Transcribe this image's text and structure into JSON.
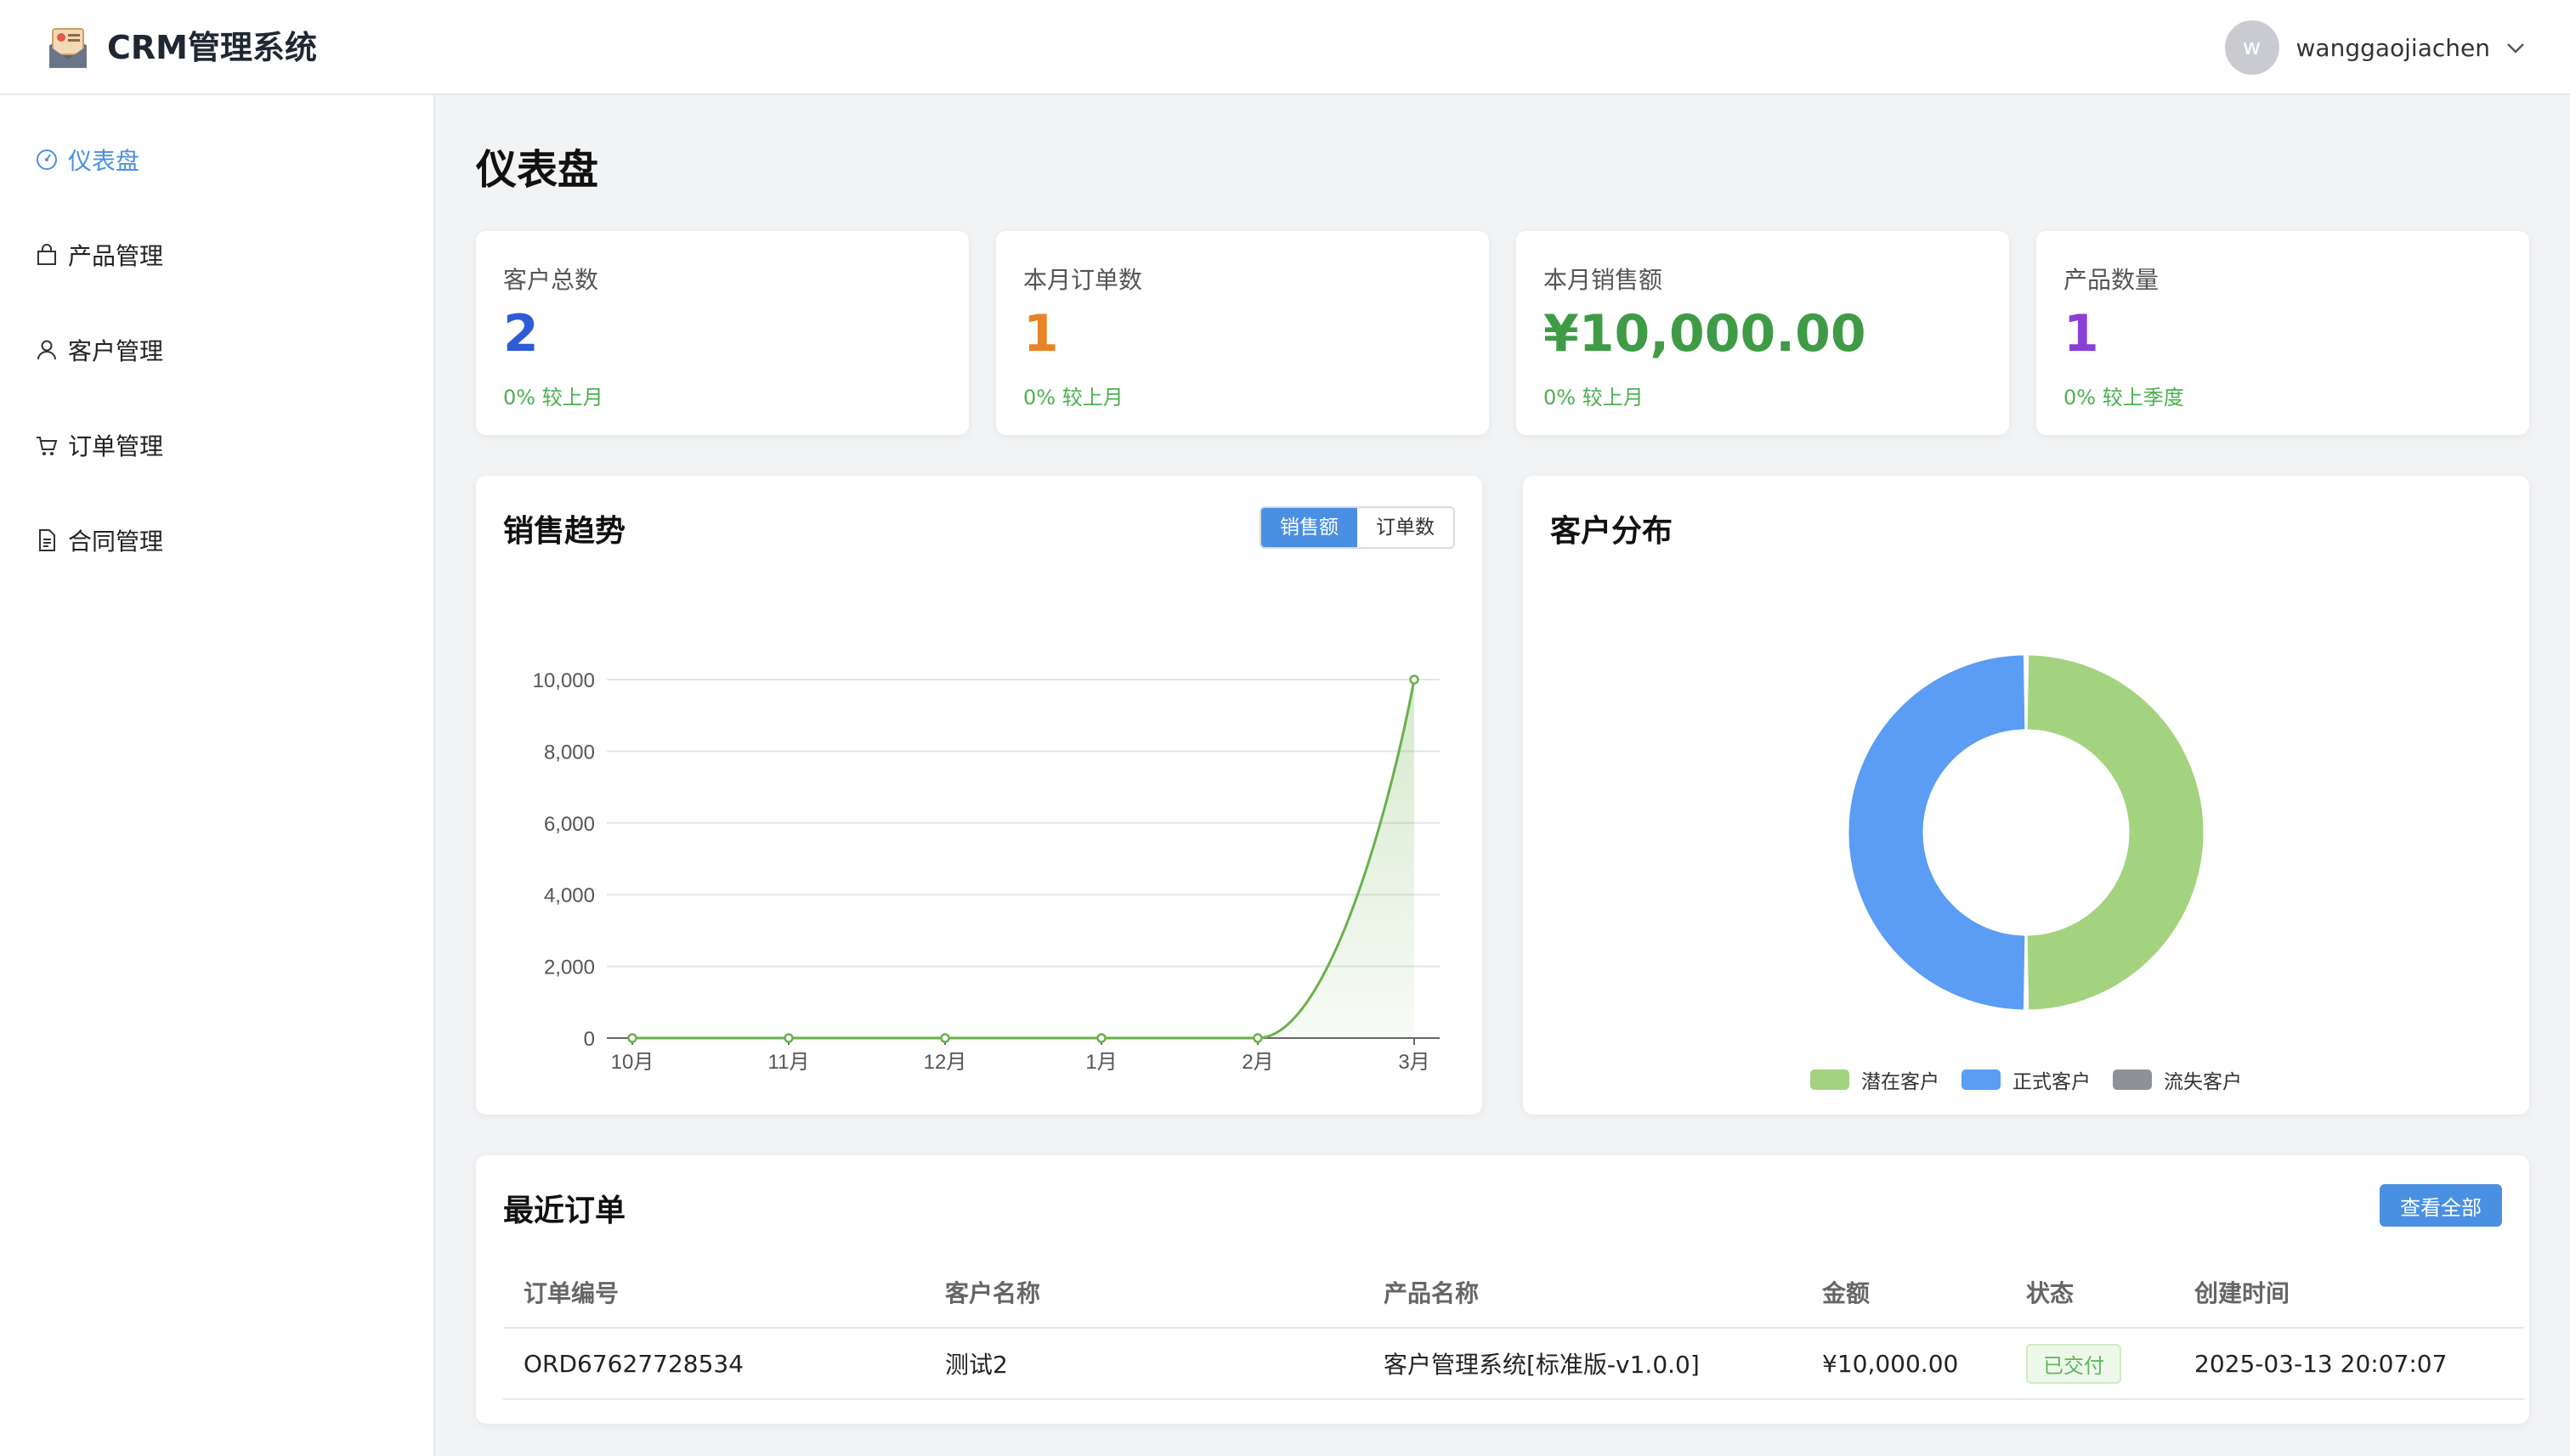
{
  "header": {
    "app_title": "CRM管理系统",
    "avatar_letter": "w",
    "username": "wanggaojiachen"
  },
  "sidebar": {
    "items": [
      {
        "label": "仪表盘",
        "icon": "dashboard-icon",
        "active": true
      },
      {
        "label": "产品管理",
        "icon": "shopping-bag-icon",
        "active": false
      },
      {
        "label": "客户管理",
        "icon": "user-icon",
        "active": false
      },
      {
        "label": "订单管理",
        "icon": "cart-icon",
        "active": false
      },
      {
        "label": "合同管理",
        "icon": "document-icon",
        "active": false
      }
    ]
  },
  "page": {
    "title": "仪表盘"
  },
  "stats": [
    {
      "label": "客户总数",
      "value": "2",
      "change": "0% 较上月",
      "color": "#2f5bd6"
    },
    {
      "label": "本月订单数",
      "value": "1",
      "change": "0% 较上月",
      "color": "#e8832a"
    },
    {
      "label": "本月销售额",
      "value": "¥10,000.00",
      "change": "0% 较上月",
      "color": "#3f9b45"
    },
    {
      "label": "产品数量",
      "value": "1",
      "change": "0% 较上季度",
      "color": "#8b3fd6"
    }
  ],
  "sales_panel": {
    "title": "销售趋势",
    "toggle": [
      "销售额",
      "订单数"
    ],
    "active_toggle": 0
  },
  "customer_panel": {
    "title": "客户分布"
  },
  "recent_orders": {
    "title": "最近订单",
    "view_all": "查看全部",
    "columns": [
      "订单编号",
      "客户名称",
      "产品名称",
      "金额",
      "状态",
      "创建时间"
    ],
    "rows": [
      [
        "ORD67627728534",
        "测试2",
        "客户管理系统[标准版-v1.0.0]",
        "¥10,000.00",
        "已交付",
        "2025-03-13 20:07:07"
      ]
    ]
  },
  "chart_data": [
    {
      "type": "area",
      "title": "销售趋势",
      "categories": [
        "10月",
        "11月",
        "12月",
        "1月",
        "2月",
        "3月"
      ],
      "series": [
        {
          "values": [
            0,
            0,
            0,
            0,
            0,
            10000
          ]
        }
      ],
      "ylim": [
        0,
        10000
      ],
      "yticks": [
        0,
        2000,
        4000,
        6000,
        8000,
        10000
      ],
      "ytick_labels": [
        "0",
        "2,000",
        "4,000",
        "6,000",
        "8,000",
        "10,000"
      ],
      "grid": true,
      "color": "#6ab04c"
    },
    {
      "type": "pie",
      "title": "客户分布",
      "donut": true,
      "labels": [
        "潜在客户",
        "正式客户",
        "流失客户"
      ],
      "values": [
        1,
        1,
        0
      ],
      "colors": [
        "#a3d37f",
        "#5b9cf5",
        "#8e9196"
      ],
      "legend": "bottom"
    }
  ]
}
